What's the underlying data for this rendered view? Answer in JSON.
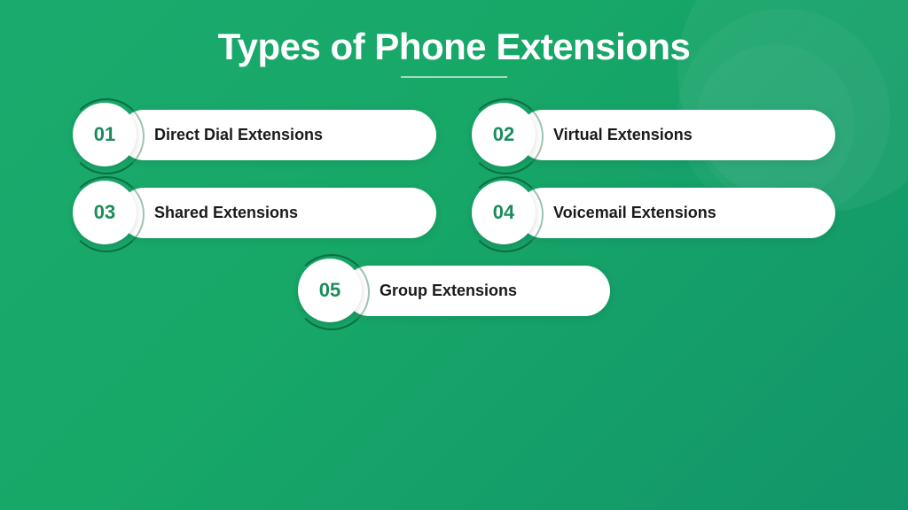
{
  "page": {
    "title": "Types of Phone Extensions",
    "divider": true
  },
  "items": [
    {
      "id": "item-1",
      "number": "01",
      "label": "Direct Dial Extensions"
    },
    {
      "id": "item-2",
      "number": "02",
      "label": "Virtual Extensions"
    },
    {
      "id": "item-3",
      "number": "03",
      "label": "Shared Extensions"
    },
    {
      "id": "item-4",
      "number": "04",
      "label": "Voicemail Extensions"
    },
    {
      "id": "item-5",
      "number": "05",
      "label": "Group Extensions"
    }
  ],
  "colors": {
    "background_start": "#1aaa6e",
    "background_end": "#12956a",
    "badge_text": "#1a8c5a",
    "label_text": "#1a1a1a",
    "title_text": "#ffffff"
  }
}
